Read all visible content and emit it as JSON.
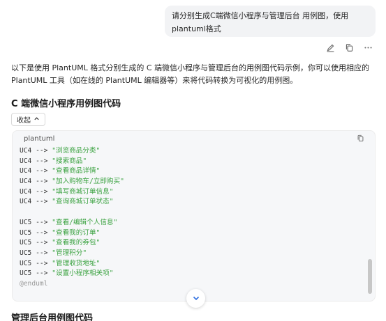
{
  "user_message": "请分别生成C端微信小程序与管理后台 用例图，使用plantuml格式",
  "actions": {
    "edit": "edit-icon",
    "copy": "copy-icon",
    "more": "more-icon"
  },
  "answer": {
    "intro": "以下是使用 PlantUML 格式分别生成的 C 端微信小程序与管理后台的用例图代码示例，你可以使用相应的 PlantUML 工具（如在线的 PlantUML 编辑器等）来将代码转换为可视化的用例图。",
    "section1_title": "C 端微信小程序用例图代码",
    "collapse_label": "收起",
    "code_lang": "plantuml",
    "code_lines": [
      {
        "actor": "UC4",
        "arrow": "-->",
        "text": "\"浏览商品分类\""
      },
      {
        "actor": "UC4",
        "arrow": "-->",
        "text": "\"搜索商品\""
      },
      {
        "actor": "UC4",
        "arrow": "-->",
        "text": "\"查看商品详情\""
      },
      {
        "actor": "UC4",
        "arrow": "-->",
        "text": "\"加入购物车/立即购买\""
      },
      {
        "actor": "UC4",
        "arrow": "-->",
        "text": "\"填写商城订单信息\""
      },
      {
        "actor": "UC4",
        "arrow": "-->",
        "text": "\"查询商城订单状态\""
      },
      {
        "actor": "",
        "arrow": "",
        "text": ""
      },
      {
        "actor": "UC5",
        "arrow": "-->",
        "text": "\"查看/编辑个人信息\""
      },
      {
        "actor": "UC5",
        "arrow": "-->",
        "text": "\"查看我的订单\""
      },
      {
        "actor": "UC5",
        "arrow": "-->",
        "text": "\"查看我的券包\""
      },
      {
        "actor": "UC5",
        "arrow": "-->",
        "text": "\"管理积分\""
      },
      {
        "actor": "UC5",
        "arrow": "-->",
        "text": "\"管理收货地址\""
      },
      {
        "actor": "UC5",
        "arrow": "-->",
        "text": "\"设置小程序相关项\""
      }
    ],
    "code_end": "@enduml",
    "section2_title": "管理后台用例图代码"
  },
  "colors": {
    "string": "#3aa240",
    "bubble": "#f2f3f5",
    "code_bg": "#f6f7f9"
  }
}
